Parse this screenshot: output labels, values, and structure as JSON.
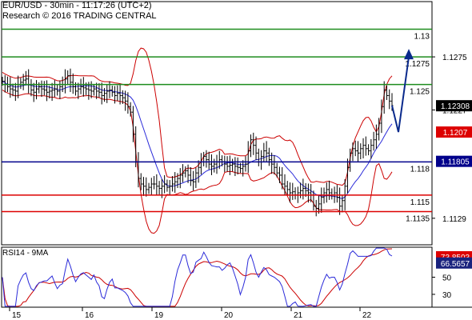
{
  "header": {
    "line1": "EUR/USD - 30min - 11:17:26 (UTC+2)",
    "line2": "Research © 2016 TRADING CENTRAL"
  },
  "rsi": {
    "title": "RSI14 - 9MA",
    "ylim": [
      15,
      85
    ],
    "ticks": [
      {
        "v": 50,
        "label": "50"
      },
      {
        "v": 30,
        "label": "30"
      }
    ],
    "badges": [
      {
        "v": 73.8503,
        "label": "73.8503",
        "color": "#dd0000"
      },
      {
        "v": 66.5657,
        "label": "66.5657",
        "color": "#1a237e"
      }
    ]
  },
  "colors": {
    "resistance": "#1e8c1e",
    "pivot": "#00008b",
    "support": "#dd0000",
    "candles": "#000000",
    "bollinger": "#cc0000",
    "moving_average": "#2b2bd9",
    "forecast_arrow": "#0a2a8c",
    "price_badge": "#000000",
    "pivot_badge": "#00008b",
    "prev_badge": "#dd0000",
    "rsi_line": "#2b2bd9",
    "rsi_ma": "#cc0000",
    "frame": "#000000",
    "grid": "#000000"
  },
  "chart_data": {
    "type": "candlestick",
    "ylim": [
      1.1105,
      1.1325
    ],
    "x_ticks": [
      "15",
      "16",
      "19",
      "20",
      "21",
      "22"
    ],
    "y_ticks": [
      {
        "v": 1.1275,
        "label": "1.1275"
      },
      {
        "v": 1.1227,
        "label": "1.1227"
      },
      {
        "v": 1.1129,
        "label": "1.1129"
      }
    ],
    "levels": [
      {
        "value": 1.13,
        "label": "1.13",
        "kind": "resistance"
      },
      {
        "value": 1.1275,
        "label": "1.1275",
        "kind": "resistance"
      },
      {
        "value": 1.125,
        "label": "1.125",
        "kind": "resistance"
      },
      {
        "value": 1.118,
        "label": "1.118",
        "kind": "pivot"
      },
      {
        "value": 1.115,
        "label": "1.115",
        "kind": "support"
      },
      {
        "value": 1.1135,
        "label": "1.1135",
        "kind": "support"
      }
    ],
    "badges": [
      {
        "v": 1.12308,
        "label": "1.12308",
        "kind": "price"
      },
      {
        "v": 1.1207,
        "label": "1.1207",
        "kind": "prev"
      },
      {
        "v": 1.11805,
        "label": "1.11805",
        "kind": "pivot"
      }
    ],
    "price_path": [
      1.1253,
      1.125,
      1.1248,
      1.1246,
      1.1245,
      1.1244,
      1.125,
      1.1252,
      1.1254,
      1.1255,
      1.125,
      1.1245,
      1.1243,
      1.1246,
      1.1248,
      1.1246,
      1.1245,
      1.1243,
      1.1244,
      1.1245,
      1.1246,
      1.1244,
      1.1248,
      1.125,
      1.1255,
      1.1258,
      1.1252,
      1.1248,
      1.1244,
      1.1246,
      1.1248,
      1.1247,
      1.1246,
      1.1245,
      1.1244,
      1.1246,
      1.1244,
      1.1243,
      1.124,
      1.1242,
      1.1244,
      1.1245,
      1.1243,
      1.124,
      1.1242,
      1.124,
      1.1238,
      1.1235,
      1.123,
      1.1225,
      1.1205,
      1.118,
      1.1165,
      1.116,
      1.1158,
      1.1155,
      1.1157,
      1.116,
      1.116,
      1.1158,
      1.1156,
      1.1158,
      1.116,
      1.1157,
      1.1158,
      1.116,
      1.1162,
      1.1165,
      1.1168,
      1.117,
      1.1172,
      1.1168,
      1.1163,
      1.1162,
      1.117,
      1.1175,
      1.118,
      1.1185,
      1.1182,
      1.1178,
      1.1176,
      1.1178,
      1.118,
      1.1182,
      1.118,
      1.1178,
      1.1176,
      1.1177,
      1.1178,
      1.1176,
      1.1175,
      1.1174,
      1.1176,
      1.1178,
      1.119,
      1.12,
      1.1195,
      1.1188,
      1.118,
      1.1185,
      1.119,
      1.1188,
      1.1182,
      1.1178,
      1.1175,
      1.117,
      1.1168,
      1.116,
      1.1158,
      1.1155,
      1.1152,
      1.1153,
      1.115,
      1.1152,
      1.1154,
      1.1156,
      1.1154,
      1.1152,
      1.115,
      1.114,
      1.1138,
      1.1142,
      1.1148,
      1.1152,
      1.1155,
      1.1152,
      1.115,
      1.1152,
      1.1148,
      1.114,
      1.1145,
      1.1158,
      1.1175,
      1.1188,
      1.1192,
      1.119,
      1.1188,
      1.1192,
      1.1195,
      1.1192,
      1.119,
      1.1195,
      1.12,
      1.1205,
      1.1215,
      1.123,
      1.1245,
      1.124,
      1.1235,
      1.1231
    ],
    "forecast": [
      1.1231,
      1.1207,
      1.1275
    ]
  }
}
